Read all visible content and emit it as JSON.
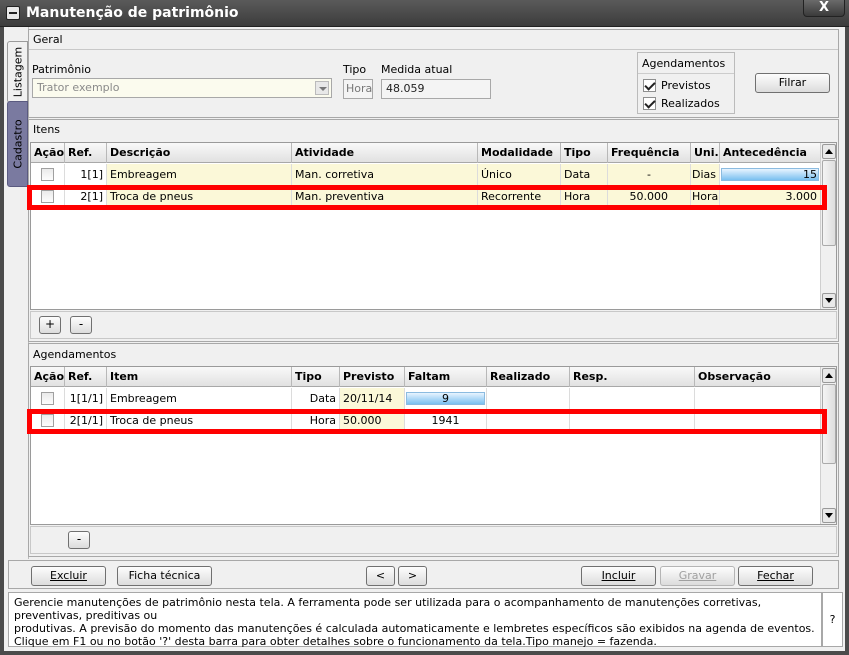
{
  "window": {
    "title": "Manutenção de patrimônio",
    "close_label": "X"
  },
  "side_tabs": [
    {
      "label": "Listagem"
    },
    {
      "label": "Cadastro"
    }
  ],
  "general": {
    "section_label": "Geral",
    "patrimonio_label": "Patrimônio",
    "patrimonio_value": "Trator exemplo",
    "tipo_label": "Tipo",
    "tipo_value": "Hora",
    "medida_label": "Medida atual",
    "medida_value": "48.059",
    "agendamentos_title": "Agendamentos",
    "previstos_label": "Previstos",
    "realizados_label": "Realizados",
    "filter_button": "Filrar"
  },
  "items": {
    "section_label": "Itens",
    "columns": [
      "Ação",
      "Ref.",
      "Descrição",
      "Atividade",
      "Modalidade",
      "Tipo",
      "Frequência",
      "Uni.",
      "Antecedência"
    ],
    "rows": [
      {
        "ref": "1[1]",
        "descricao": "Embreagem",
        "atividade": "Man. corretiva",
        "modalidade": "Único",
        "tipo": "Data",
        "frequencia": "-",
        "uni": "Dias",
        "antecedencia": "15"
      },
      {
        "ref": "2[1]",
        "descricao": "Troca de pneus",
        "atividade": "Man. preventiva",
        "modalidade": "Recorrente",
        "tipo": "Hora",
        "frequencia": "50.000",
        "uni": "Hora",
        "antecedencia": "3.000"
      }
    ],
    "add_button": "+",
    "remove_button": "-"
  },
  "schedules": {
    "section_label": "Agendamentos",
    "columns": [
      "Ação",
      "Ref.",
      "Item",
      "Tipo",
      "Previsto",
      "Faltam",
      "Realizado",
      "Resp.",
      "Observação"
    ],
    "rows": [
      {
        "ref": "1[1/1]",
        "item": "Embreagem",
        "tipo": "Data",
        "previsto": "20/11/14",
        "faltam": "9",
        "realizado": "",
        "resp": "",
        "observacao": ""
      },
      {
        "ref": "2[1/1]",
        "item": "Troca de pneus",
        "tipo": "Hora",
        "previsto": "50.000",
        "faltam": "1941",
        "realizado": "",
        "resp": "",
        "observacao": ""
      }
    ],
    "remove_button": "-"
  },
  "footer": {
    "excluir": "Excluir",
    "ficha": "Ficha técnica",
    "prev": "<",
    "next": ">",
    "incluir": "Incluir",
    "gravar": "Gravar",
    "fechar": "Fechar"
  },
  "status": {
    "line1": "Gerencie manutenções de patrimônio nesta tela. A ferramenta pode ser utilizada para o acompanhamento de manutenções corretivas, preventivas, preditivas ou",
    "line2": "produtivas. A previsão do momento das manutenções é calculada automaticamente e lembretes específicos são exibidos na agenda de eventos.",
    "line3": "Clique em F1 ou no botão '?' desta barra para obter detalhes sobre o funcionamento da tela.Tipo manejo = fazenda.",
    "help": "?"
  },
  "colors": {
    "highlight": "#ff0000",
    "titlebar": "#3c3c3c",
    "active_tab": "#7a7aa0",
    "bar": "#7ac0f0"
  }
}
